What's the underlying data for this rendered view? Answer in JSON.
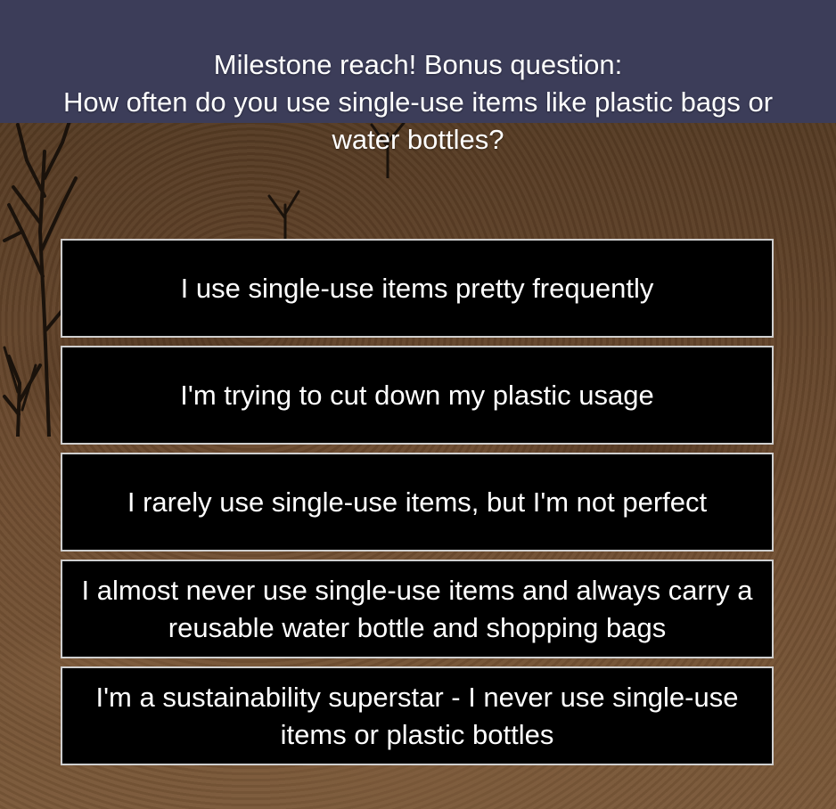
{
  "colors": {
    "header_bg": "#3c3d59",
    "button_bg": "#000000",
    "button_border": "#cfcfcf",
    "text": "#ffffff"
  },
  "question": {
    "text": "Milestone reach! Bonus question:\nHow often do you use single-use items like plastic bags or water bottles?"
  },
  "options": [
    "I use single-use items pretty frequently",
    "I'm trying to cut down my plastic usage",
    "I rarely use single-use items, but I'm not perfect",
    "I almost never use single-use items and always carry a reusable water bottle and shopping bags",
    "I'm a sustainability superstar - I never use single-use items or plastic bottles"
  ]
}
